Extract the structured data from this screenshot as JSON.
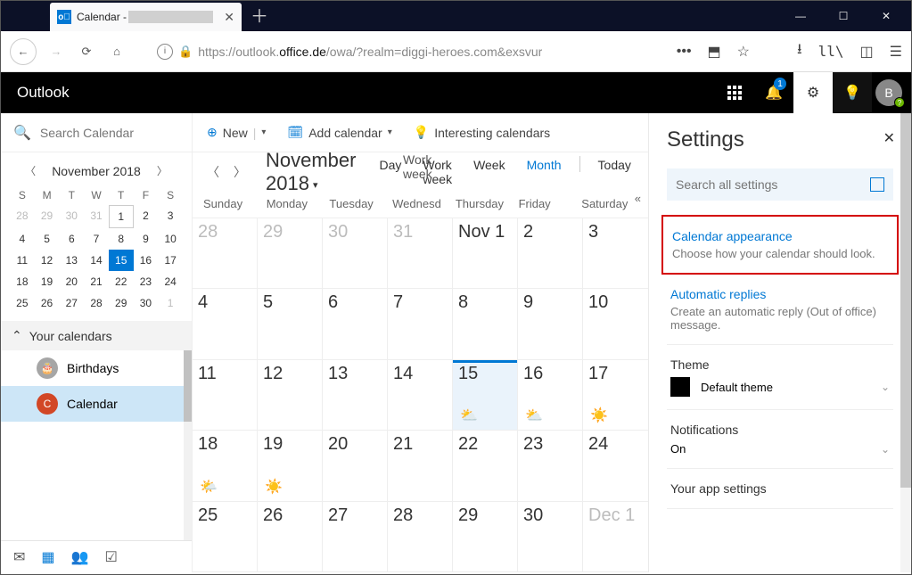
{
  "browser": {
    "tab_title": "Calendar -",
    "url_prefix": "https://outlook.",
    "url_domain": "office.de",
    "url_rest": "/owa/?realm=diggi-heroes.com&exsvur"
  },
  "header": {
    "brand": "Outlook",
    "notif_count": "1",
    "avatar_initial": "B",
    "avatar_status": "?"
  },
  "sidebar": {
    "search_placeholder": "Search Calendar",
    "mini_title": "November 2018",
    "dow": [
      "S",
      "M",
      "T",
      "W",
      "T",
      "F",
      "S"
    ],
    "mini_days": [
      {
        "n": "28",
        "mute": true
      },
      {
        "n": "29",
        "mute": true
      },
      {
        "n": "30",
        "mute": true
      },
      {
        "n": "31",
        "mute": true
      },
      {
        "n": "1",
        "box": true
      },
      {
        "n": "2"
      },
      {
        "n": "3"
      },
      {
        "n": "4"
      },
      {
        "n": "5"
      },
      {
        "n": "6"
      },
      {
        "n": "7"
      },
      {
        "n": "8"
      },
      {
        "n": "9"
      },
      {
        "n": "10"
      },
      {
        "n": "11"
      },
      {
        "n": "12"
      },
      {
        "n": "13"
      },
      {
        "n": "14"
      },
      {
        "n": "15",
        "today": true
      },
      {
        "n": "16"
      },
      {
        "n": "17"
      },
      {
        "n": "18"
      },
      {
        "n": "19"
      },
      {
        "n": "20"
      },
      {
        "n": "21"
      },
      {
        "n": "22"
      },
      {
        "n": "23"
      },
      {
        "n": "24"
      },
      {
        "n": "25"
      },
      {
        "n": "26"
      },
      {
        "n": "27"
      },
      {
        "n": "28"
      },
      {
        "n": "29"
      },
      {
        "n": "30"
      },
      {
        "n": "1",
        "mute": true
      }
    ],
    "your_calendars_label": "Your calendars",
    "calendars": [
      {
        "name": "Calendar",
        "color": "orange",
        "initial": "C",
        "selected": true
      },
      {
        "name": "Birthdays",
        "color": "gray",
        "initial": "🎂",
        "selected": false
      }
    ]
  },
  "toolbar": {
    "new_label": "New",
    "add_calendar_label": "Add calendar",
    "interesting_label": "Interesting calendars"
  },
  "viewbar": {
    "title": "November 2018",
    "inline_views": "Work week",
    "views": [
      "Day",
      "Work week",
      "Week",
      "Month"
    ],
    "active_view": "Month",
    "today_label": "Today"
  },
  "weekdays": [
    "Sunday",
    "Monday",
    "Tuesday",
    "Wednesd",
    "Thursday",
    "Friday",
    "Saturday"
  ],
  "grid": [
    [
      {
        "t": "28"
      },
      {
        "t": "29"
      },
      {
        "t": "30"
      },
      {
        "t": "31"
      },
      {
        "t": "Nov 1",
        "cur": true
      },
      {
        "t": "2",
        "cur": true
      },
      {
        "t": "3",
        "cur": true
      }
    ],
    [
      {
        "t": "4",
        "cur": true
      },
      {
        "t": "5",
        "cur": true
      },
      {
        "t": "6",
        "cur": true
      },
      {
        "t": "7",
        "cur": true
      },
      {
        "t": "8",
        "cur": true
      },
      {
        "t": "9",
        "cur": true
      },
      {
        "t": "10",
        "cur": true
      }
    ],
    [
      {
        "t": "11",
        "cur": true
      },
      {
        "t": "12",
        "cur": true
      },
      {
        "t": "13",
        "cur": true
      },
      {
        "t": "14",
        "cur": true
      },
      {
        "t": "15",
        "cur": true,
        "today": true,
        "wx": "⛅"
      },
      {
        "t": "16",
        "cur": true,
        "wx": "⛅"
      },
      {
        "t": "17",
        "cur": true,
        "wx": "☀️"
      }
    ],
    [
      {
        "t": "18",
        "cur": true,
        "wx": "🌤️"
      },
      {
        "t": "19",
        "cur": true,
        "wx": "☀️"
      },
      {
        "t": "20",
        "cur": true
      },
      {
        "t": "21",
        "cur": true
      },
      {
        "t": "22",
        "cur": true
      },
      {
        "t": "23",
        "cur": true
      },
      {
        "t": "24",
        "cur": true
      }
    ],
    [
      {
        "t": "25",
        "cur": true
      },
      {
        "t": "26",
        "cur": true
      },
      {
        "t": "27",
        "cur": true
      },
      {
        "t": "28",
        "cur": true
      },
      {
        "t": "29",
        "cur": true
      },
      {
        "t": "30",
        "cur": true
      },
      {
        "t": "Dec 1"
      }
    ]
  ],
  "settings": {
    "title": "Settings",
    "search_placeholder": "Search all settings",
    "items": [
      {
        "title": "Calendar appearance",
        "desc": "Choose how your calendar should look.",
        "link": true,
        "highlight": true
      },
      {
        "title": "Automatic replies",
        "desc": "Create an automatic reply (Out of office) message.",
        "link": true
      },
      {
        "title": "Theme",
        "value": "Default theme",
        "plain": true,
        "chev": true,
        "swatch": true
      },
      {
        "title": "Notifications",
        "value": "On",
        "plain": true,
        "chev": true
      },
      {
        "title": "Your app settings",
        "plain": true
      }
    ]
  }
}
